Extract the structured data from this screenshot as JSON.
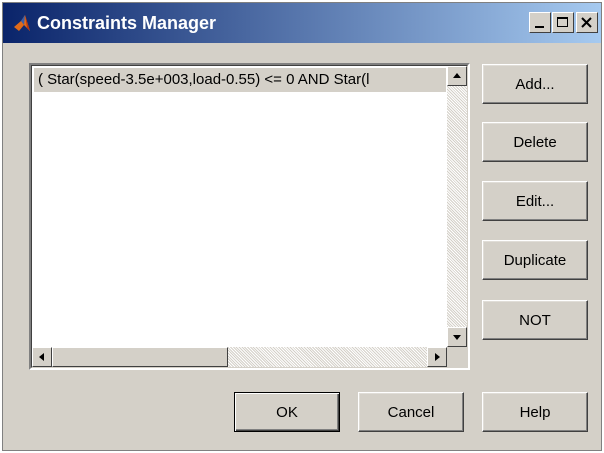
{
  "window": {
    "title": "Constraints Manager"
  },
  "icons": {
    "app": "matlab-logo-icon",
    "minimize": "minimize-icon",
    "maximize": "maximize-icon",
    "close": "close-icon",
    "scroll_up": "arrow-up-icon",
    "scroll_down": "arrow-down-icon",
    "scroll_left": "arrow-left-icon",
    "scroll_right": "arrow-right-icon"
  },
  "constraints_list": {
    "items": [
      "( Star(speed-3.5e+003,load-0.55) <= 0 AND Star(l"
    ]
  },
  "side_buttons": {
    "add": "Add...",
    "delete": "Delete",
    "edit": "Edit...",
    "duplicate": "Duplicate",
    "not": "NOT"
  },
  "bottom_buttons": {
    "ok": "OK",
    "cancel": "Cancel",
    "help": "Help"
  },
  "colors": {
    "titlebar_start": "#0a246a",
    "titlebar_end": "#a6caf0",
    "face": "#d4d0c8",
    "selection": "#d4d0c8"
  }
}
